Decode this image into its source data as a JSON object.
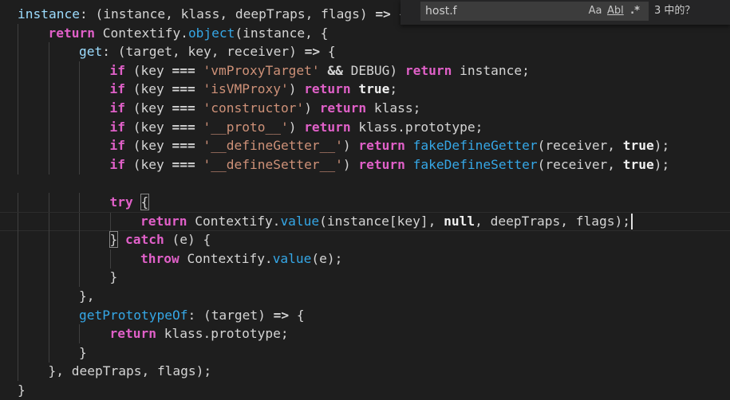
{
  "editor": {
    "lines": [
      {
        "indent": 0,
        "tokens": [
          {
            "t": "instance",
            "c": "key"
          },
          {
            "t": ": (instance, klass, deepTraps, flags) ",
            "c": "id"
          },
          {
            "t": "=>",
            "c": "op"
          },
          {
            "t": " {",
            "c": "id"
          }
        ]
      },
      {
        "indent": 1,
        "tokens": [
          {
            "t": "return",
            "c": "kw"
          },
          {
            "t": " Contextify.",
            "c": "id"
          },
          {
            "t": "object",
            "c": "fn"
          },
          {
            "t": "(instance, {",
            "c": "id"
          }
        ]
      },
      {
        "indent": 2,
        "tokens": [
          {
            "t": "get",
            "c": "key"
          },
          {
            "t": ": (target, key, receiver) ",
            "c": "id"
          },
          {
            "t": "=>",
            "c": "op"
          },
          {
            "t": " {",
            "c": "id"
          }
        ]
      },
      {
        "indent": 3,
        "tokens": [
          {
            "t": "if",
            "c": "kw"
          },
          {
            "t": " (key ",
            "c": "id"
          },
          {
            "t": "===",
            "c": "op"
          },
          {
            "t": " ",
            "c": "id"
          },
          {
            "t": "'vmProxyTarget'",
            "c": "str"
          },
          {
            "t": " ",
            "c": "id"
          },
          {
            "t": "&&",
            "c": "op"
          },
          {
            "t": " DEBUG) ",
            "c": "id"
          },
          {
            "t": "return",
            "c": "kw"
          },
          {
            "t": " instance;",
            "c": "id"
          }
        ]
      },
      {
        "indent": 3,
        "tokens": [
          {
            "t": "if",
            "c": "kw"
          },
          {
            "t": " (key ",
            "c": "id"
          },
          {
            "t": "===",
            "c": "op"
          },
          {
            "t": " ",
            "c": "id"
          },
          {
            "t": "'isVMProxy'",
            "c": "str"
          },
          {
            "t": ") ",
            "c": "id"
          },
          {
            "t": "return",
            "c": "kw"
          },
          {
            "t": " ",
            "c": "id"
          },
          {
            "t": "true",
            "c": "bool"
          },
          {
            "t": ";",
            "c": "id"
          }
        ]
      },
      {
        "indent": 3,
        "tokens": [
          {
            "t": "if",
            "c": "kw"
          },
          {
            "t": " (key ",
            "c": "id"
          },
          {
            "t": "===",
            "c": "op"
          },
          {
            "t": " ",
            "c": "id"
          },
          {
            "t": "'constructor'",
            "c": "str"
          },
          {
            "t": ") ",
            "c": "id"
          },
          {
            "t": "return",
            "c": "kw"
          },
          {
            "t": " klass;",
            "c": "id"
          }
        ]
      },
      {
        "indent": 3,
        "tokens": [
          {
            "t": "if",
            "c": "kw"
          },
          {
            "t": " (key ",
            "c": "id"
          },
          {
            "t": "===",
            "c": "op"
          },
          {
            "t": " ",
            "c": "id"
          },
          {
            "t": "'__proto__'",
            "c": "str"
          },
          {
            "t": ") ",
            "c": "id"
          },
          {
            "t": "return",
            "c": "kw"
          },
          {
            "t": " klass.prototype;",
            "c": "id"
          }
        ]
      },
      {
        "indent": 3,
        "tokens": [
          {
            "t": "if",
            "c": "kw"
          },
          {
            "t": " (key ",
            "c": "id"
          },
          {
            "t": "===",
            "c": "op"
          },
          {
            "t": " ",
            "c": "id"
          },
          {
            "t": "'__defineGetter__'",
            "c": "str"
          },
          {
            "t": ") ",
            "c": "id"
          },
          {
            "t": "return",
            "c": "kw"
          },
          {
            "t": " ",
            "c": "id"
          },
          {
            "t": "fakeDefineGetter",
            "c": "fn"
          },
          {
            "t": "(receiver, ",
            "c": "id"
          },
          {
            "t": "true",
            "c": "bool"
          },
          {
            "t": ");",
            "c": "id"
          }
        ]
      },
      {
        "indent": 3,
        "tokens": [
          {
            "t": "if",
            "c": "kw"
          },
          {
            "t": " (key ",
            "c": "id"
          },
          {
            "t": "===",
            "c": "op"
          },
          {
            "t": " ",
            "c": "id"
          },
          {
            "t": "'__defineSetter__'",
            "c": "str"
          },
          {
            "t": ") ",
            "c": "id"
          },
          {
            "t": "return",
            "c": "kw"
          },
          {
            "t": " ",
            "c": "id"
          },
          {
            "t": "fakeDefineSetter",
            "c": "fn"
          },
          {
            "t": "(receiver, ",
            "c": "id"
          },
          {
            "t": "true",
            "c": "bool"
          },
          {
            "t": ");",
            "c": "id"
          }
        ]
      },
      {
        "indent": 0,
        "tokens": []
      },
      {
        "indent": 3,
        "tokens": [
          {
            "t": "try",
            "c": "kw"
          },
          {
            "t": " ",
            "c": "id"
          },
          {
            "t": "{",
            "c": "id",
            "m": true
          }
        ]
      },
      {
        "indent": 4,
        "current": true,
        "caret": true,
        "tokens": [
          {
            "t": "return",
            "c": "kw"
          },
          {
            "t": " Contextify.",
            "c": "id"
          },
          {
            "t": "value",
            "c": "fn"
          },
          {
            "t": "(instance[key], ",
            "c": "id"
          },
          {
            "t": "null",
            "c": "bool"
          },
          {
            "t": ", deepTraps, flags);",
            "c": "id"
          }
        ]
      },
      {
        "indent": 3,
        "tokens": [
          {
            "t": "}",
            "c": "id",
            "m": true
          },
          {
            "t": " ",
            "c": "id"
          },
          {
            "t": "catch",
            "c": "kw"
          },
          {
            "t": " (e) {",
            "c": "id"
          }
        ]
      },
      {
        "indent": 4,
        "tokens": [
          {
            "t": "throw",
            "c": "kw"
          },
          {
            "t": " Contextify.",
            "c": "id"
          },
          {
            "t": "value",
            "c": "fn"
          },
          {
            "t": "(e);",
            "c": "id"
          }
        ]
      },
      {
        "indent": 3,
        "tokens": [
          {
            "t": "}",
            "c": "id"
          }
        ]
      },
      {
        "indent": 2,
        "tokens": [
          {
            "t": "},",
            "c": "id"
          }
        ]
      },
      {
        "indent": 2,
        "tokens": [
          {
            "t": "getPrototypeOf",
            "c": "fn"
          },
          {
            "t": ": (target) ",
            "c": "id"
          },
          {
            "t": "=>",
            "c": "op"
          },
          {
            "t": " {",
            "c": "id"
          }
        ]
      },
      {
        "indent": 3,
        "tokens": [
          {
            "t": "return",
            "c": "kw"
          },
          {
            "t": " klass.prototype;",
            "c": "id"
          }
        ]
      },
      {
        "indent": 2,
        "tokens": [
          {
            "t": "}",
            "c": "id"
          }
        ]
      },
      {
        "indent": 1,
        "tokens": [
          {
            "t": "}, deepTraps, flags);",
            "c": "id"
          }
        ]
      },
      {
        "indent": 0,
        "tokens": [
          {
            "t": "}",
            "c": "id"
          }
        ]
      }
    ]
  },
  "find": {
    "query": "host.f",
    "match_case": "Aa",
    "whole_word": "Abl",
    "regex": ".*",
    "result": "3 中的？"
  }
}
